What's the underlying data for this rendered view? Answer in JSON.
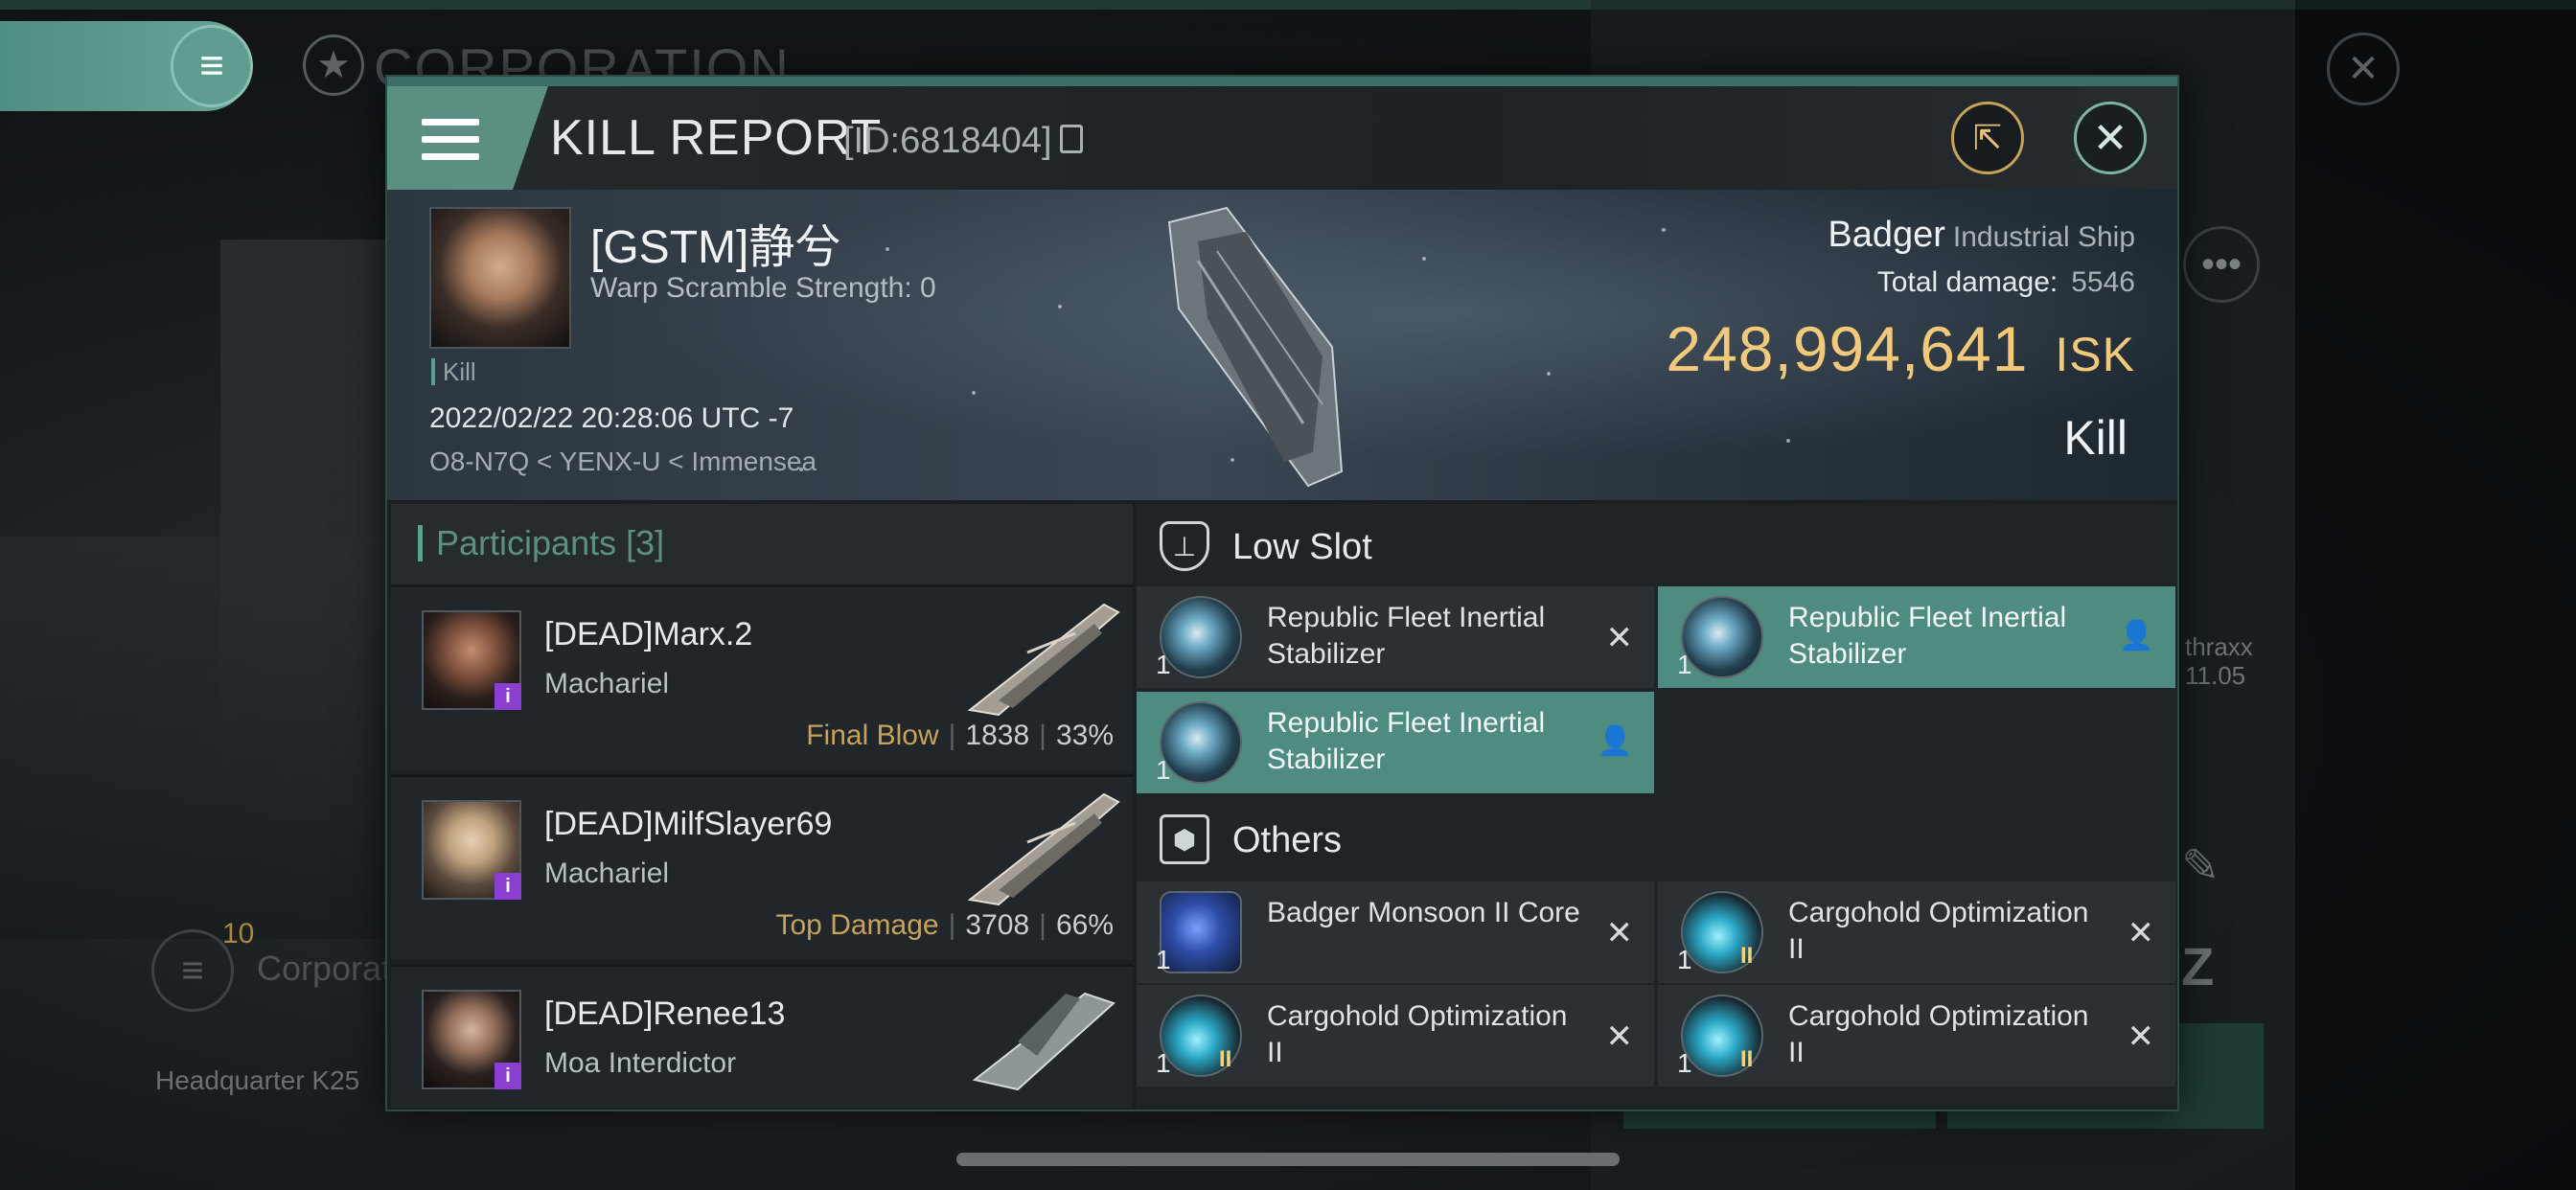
{
  "background": {
    "corp_title": "CORPORATION",
    "corp_count": "10",
    "corp_label": "Corporati",
    "headquarter": "Headquarter K25",
    "side_text_1": "thraxx",
    "side_text_2": "11.05"
  },
  "report": {
    "title": "KILL REPORT",
    "id": "[ID:6818404]"
  },
  "victim": {
    "name": "[GSTM]静兮",
    "warp": "Warp Scramble Strength: 0",
    "tag": "Kill",
    "datetime": "2022/02/22 20:28:06 UTC -7",
    "location": "O8-N7Q < YENX-U < Immensea",
    "ship_name": "Badger",
    "ship_class": "Industrial Ship",
    "total_damage_label": "Total damage:",
    "total_damage": "5546",
    "isk_value": "248,994,641",
    "isk_unit": "ISK",
    "result": "Kill"
  },
  "participants": {
    "header": "Participants",
    "count": "[3]",
    "rows": [
      {
        "name": "[DEAD]Marx.2",
        "ship": "Machariel",
        "label": "Final Blow",
        "damage": "1838",
        "percent": "33%"
      },
      {
        "name": "[DEAD]MilfSlayer69",
        "ship": "Machariel",
        "label": "Top Damage",
        "damage": "3708",
        "percent": "66%"
      },
      {
        "name": "[DEAD]Renee13",
        "ship": "Moa Interdictor"
      }
    ]
  },
  "slots": {
    "low_slot_title": "Low Slot",
    "others_title": "Others",
    "low": [
      {
        "qty": "1",
        "name": "Republic Fleet Inertial Stabilizer",
        "status": "destroyed"
      },
      {
        "qty": "1",
        "name": "Republic Fleet Inertial Stabilizer",
        "status": "dropped"
      },
      {
        "qty": "1",
        "name": "Republic Fleet Inertial Stabilizer",
        "status": "dropped"
      }
    ],
    "others": [
      {
        "qty": "1",
        "name": "Badger Monsoon II Core",
        "status": "destroyed"
      },
      {
        "qty": "1",
        "name": "Cargohold Optimization II",
        "tier": "II",
        "status": "destroyed"
      },
      {
        "qty": "1",
        "name": "Cargohold Optimization II",
        "tier": "II",
        "status": "destroyed"
      },
      {
        "qty": "1",
        "name": "Cargohold Optimization II",
        "tier": "II",
        "status": "destroyed"
      }
    ]
  },
  "colors": {
    "accent": "#5b8f84",
    "isk": "#f2c97a",
    "final_blow": "#c9a25a",
    "dropped_item": "#4e8c80"
  }
}
